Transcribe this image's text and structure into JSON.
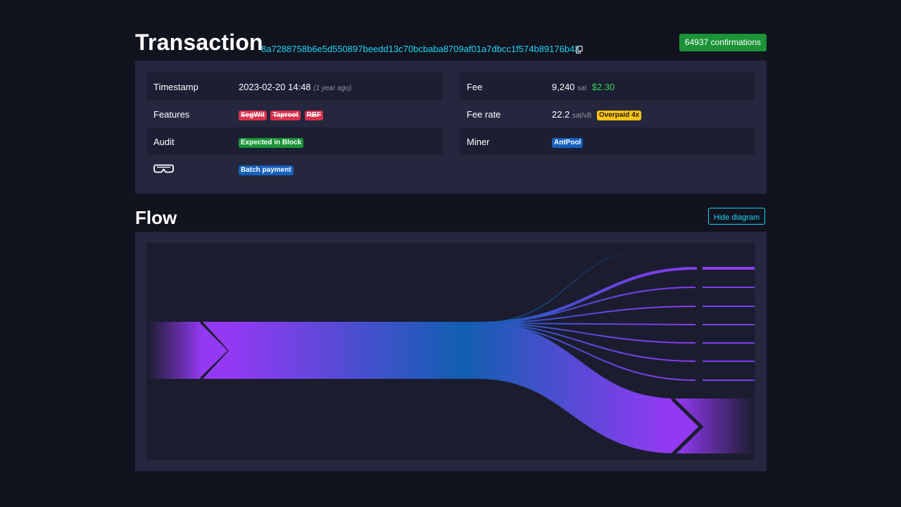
{
  "header": {
    "title": "Transaction",
    "txid": "8a7288758b6e5d550897beedd13c70bcbaba8709af01a7dbcc1f574b89176b43",
    "copy_icon": "copy-icon",
    "confirmations": "64937 confirmations"
  },
  "details": {
    "timestamp": {
      "label": "Timestamp",
      "value": "2023-02-20 14:48",
      "relative": "(1 year ago)"
    },
    "features": {
      "label": "Features",
      "badges": [
        "SegWit",
        "Taproot",
        "RBF"
      ]
    },
    "audit": {
      "label": "Audit",
      "badge": "Expected in Block"
    },
    "tags": {
      "icon": "goggles-icon",
      "badge": "Batch payment"
    },
    "fee": {
      "label": "Fee",
      "value": "9,240",
      "unit": "sat",
      "fiat": "$2.30"
    },
    "fee_rate": {
      "label": "Fee rate",
      "value": "22.2",
      "unit": "sat/vB",
      "badge": "Overpaid 4x"
    },
    "miner": {
      "label": "Miner",
      "badge": "AntPool"
    }
  },
  "flow": {
    "title": "Flow",
    "hide_button": "Hide diagram"
  },
  "colors": {
    "background": "#11131f",
    "panel": "#24273e",
    "accent": "#1bd8f4",
    "flow_purple": "#9339f4",
    "flow_blue": "#105fb0"
  }
}
